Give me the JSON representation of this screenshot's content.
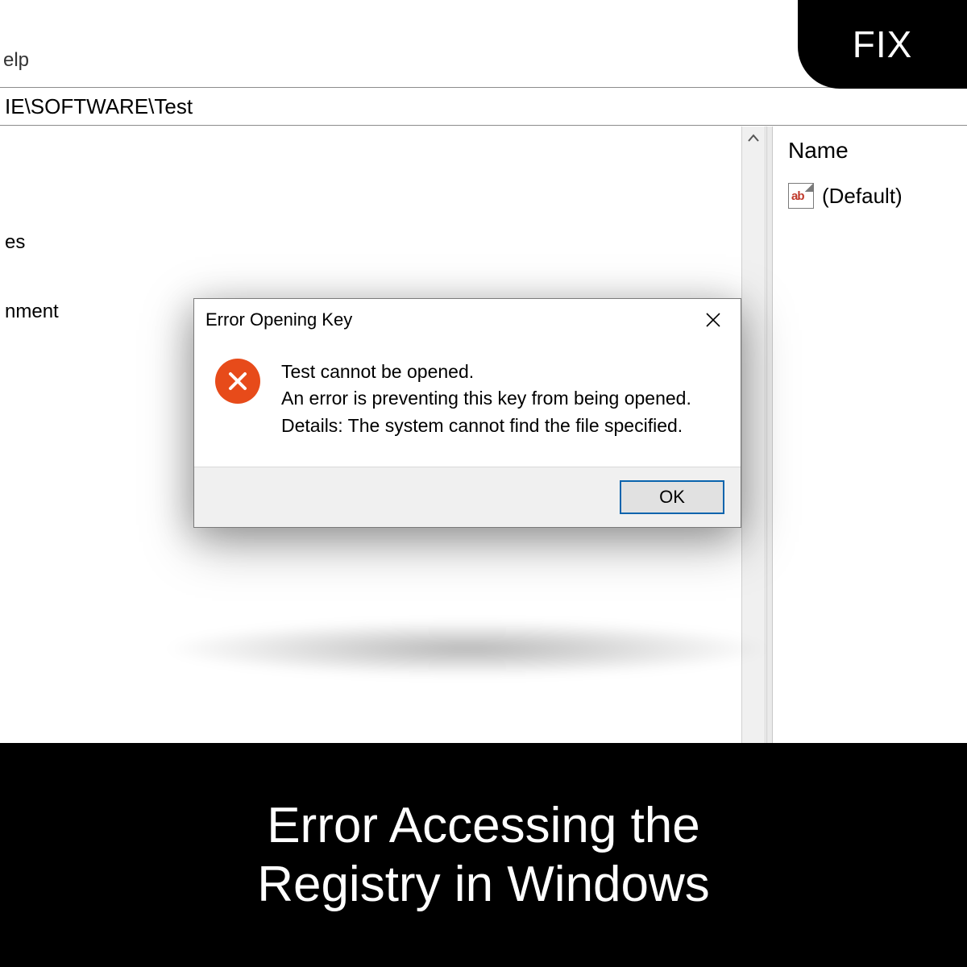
{
  "menu": {
    "help": "elp"
  },
  "address_bar": {
    "path": "IE\\SOFTWARE\\Test"
  },
  "tree": {
    "item1": "es",
    "item2": "nment"
  },
  "values_pane": {
    "column_header": "Name",
    "default_label": "(Default)",
    "icon_text": "ab"
  },
  "dialog": {
    "title": "Error Opening Key",
    "line1": "Test cannot be opened.",
    "line2": "An error is preventing this key from being opened.",
    "line3": "Details: The system cannot find the file specified.",
    "ok": "OK"
  },
  "badge": {
    "fix": "FIX"
  },
  "caption": {
    "line1": "Error Accessing the",
    "line2": "Registry in Windows"
  }
}
